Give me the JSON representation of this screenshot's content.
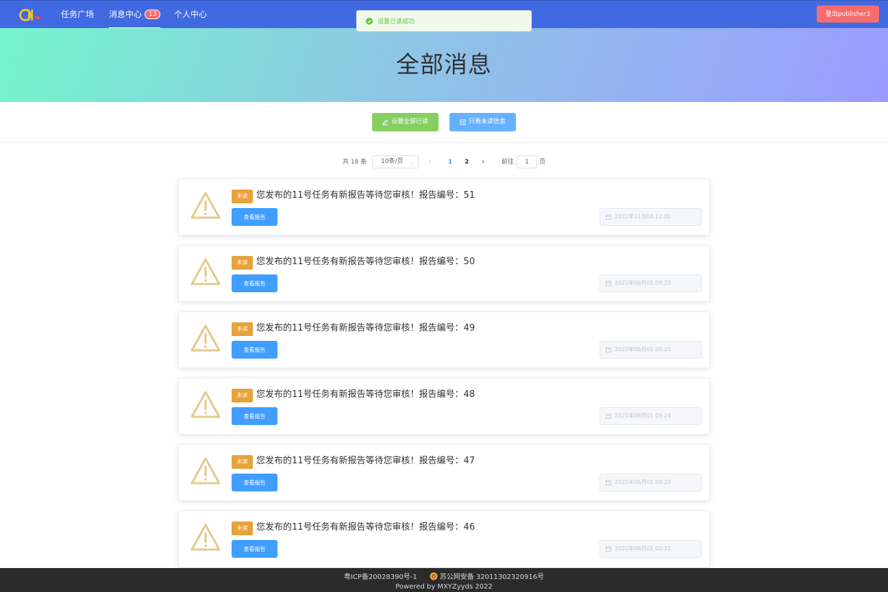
{
  "nav": {
    "items": [
      {
        "label": "任务广场"
      },
      {
        "label": "消息中心",
        "badge": "13"
      },
      {
        "label": "个人中心"
      }
    ],
    "logout_label": "登出publisher3"
  },
  "toast": {
    "text": "设置已读成功"
  },
  "banner": {
    "title": "全部消息"
  },
  "actions": {
    "mark_all_read": "设置全部已读",
    "only_unread": "只看未读信息"
  },
  "pagination": {
    "total": "共 18 条",
    "page_size": "10条/页",
    "prev": "‹",
    "pages": [
      "1",
      "2"
    ],
    "current": "1",
    "next": "›",
    "goto_prefix": "前往",
    "goto_value": "1",
    "goto_suffix": "页"
  },
  "messages": [
    {
      "tag": "未读",
      "title": "您发布的11号任务有新报告等待您审核！报告编号：51",
      "button": "查看报告",
      "date": "2022年11月04 12:00"
    },
    {
      "tag": "未读",
      "title": "您发布的11号任务有新报告等待您审核！报告编号：50",
      "button": "查看报告",
      "date": "2022年06月01 09:25"
    },
    {
      "tag": "未读",
      "title": "您发布的11号任务有新报告等待您审核！报告编号：49",
      "button": "查看报告",
      "date": "2022年06月01 09:25"
    },
    {
      "tag": "未读",
      "title": "您发布的11号任务有新报告等待您审核！报告编号：48",
      "button": "查看报告",
      "date": "2022年06月01 09:24"
    },
    {
      "tag": "未读",
      "title": "您发布的11号任务有新报告等待您审核！报告编号：47",
      "button": "查看报告",
      "date": "2022年06月01 09:23"
    },
    {
      "tag": "未读",
      "title": "您发布的11号任务有新报告等待您审核！报告编号：46",
      "button": "查看报告",
      "date": "2022年06月01 02:11"
    }
  ],
  "footer": {
    "icp": "粤ICP备20028390号-1",
    "police": "苏公网安备 32011302320916号",
    "powered": "Powered by MXYZyyds 2022"
  },
  "colors": {
    "nav_bg": "#4169e1",
    "logout": "#f56c6c",
    "green_button": "#85ce61",
    "blue_button": "#66b1ff",
    "primary": "#409eff",
    "unread_tag": "#e6a23c",
    "warning_icon": "#e3c98a",
    "footer_bg": "#2b2b2b"
  },
  "icons": {
    "toast": "check-circle-icon",
    "mark_all_read": "edit-icon",
    "only_unread": "document-icon",
    "message": "warning-triangle-icon",
    "date": "calendar-icon",
    "footer": "police-badge-icon"
  }
}
